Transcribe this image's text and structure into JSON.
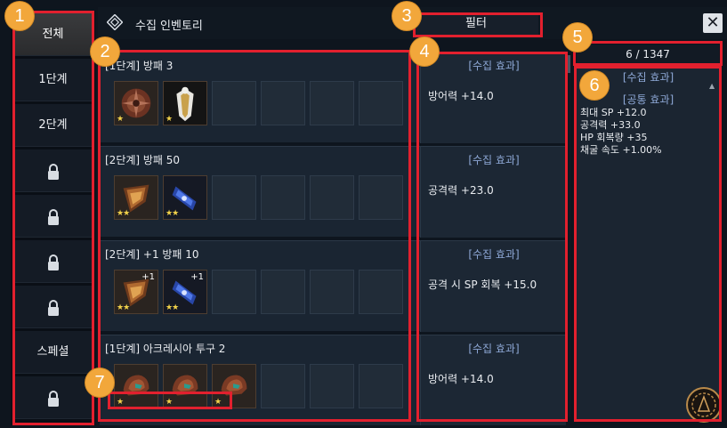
{
  "header": {
    "title": "수집 인벤토리",
    "filter_label": "필터",
    "close_label": "✕"
  },
  "tabs": [
    {
      "label": "전체",
      "locked": false,
      "active": true
    },
    {
      "label": "1단계",
      "locked": false
    },
    {
      "label": "2단계",
      "locked": false
    },
    {
      "label": "",
      "locked": true
    },
    {
      "label": "",
      "locked": true
    },
    {
      "label": "",
      "locked": true
    },
    {
      "label": "",
      "locked": true
    },
    {
      "label": "스페셜",
      "locked": false
    },
    {
      "label": "",
      "locked": true
    }
  ],
  "entries": [
    {
      "title": "[1단계] 방패 3",
      "effect_header": "[수집 효과]",
      "effect": "방어력 +14.0",
      "items": [
        {
          "icon": "ornate-shield-icon",
          "stars": "★"
        },
        {
          "icon": "white-armor-icon",
          "stars": "★"
        }
      ]
    },
    {
      "title": "[2단계] 방패 50",
      "effect_header": "[수집 효과]",
      "effect": "공격력 +23.0",
      "items": [
        {
          "icon": "bronze-shield-icon",
          "stars": "★★"
        },
        {
          "icon": "blue-shield-icon",
          "stars": "★★"
        }
      ]
    },
    {
      "title": "[2단계] +1 방패 10",
      "effect_header": "[수집 효과]",
      "effect": "공격 시 SP 회복 +15.0",
      "items": [
        {
          "icon": "bronze-shield-icon",
          "stars": "★★",
          "enh": "+1"
        },
        {
          "icon": "blue-shield-icon",
          "stars": "★★",
          "enh": "+1"
        }
      ]
    },
    {
      "title": "[1단계] 아크레시아 투구 2",
      "effect_header": "[수집 효과]",
      "effect": "방어력 +14.0",
      "items": [
        {
          "icon": "helmet-icon",
          "stars": "★"
        },
        {
          "icon": "helmet-icon",
          "stars": "★"
        },
        {
          "icon": "helmet-icon",
          "stars": "★"
        }
      ]
    }
  ],
  "summary": {
    "count": "6 / 1347",
    "header": "[수집 효과]",
    "sub_header": "[공통 효과]",
    "stats": [
      "최대 SP +12.0",
      "공격력 +33.0",
      "HP 회복량 +35",
      "채굴 속도 +1.00%"
    ]
  },
  "annotations": [
    "1",
    "2",
    "3",
    "4",
    "5",
    "6",
    "7"
  ],
  "colors": {
    "annotation_box": "#e2202e",
    "annotation_badge": "#f2a73b",
    "effect_header": "#8ea8d6",
    "star": "#f2d24a"
  }
}
